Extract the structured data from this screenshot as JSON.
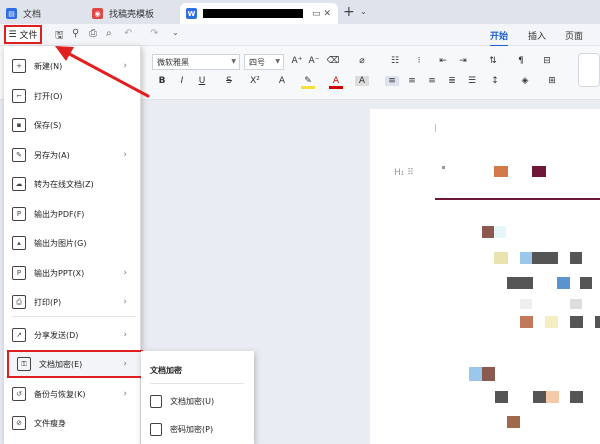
{
  "tabs": [
    {
      "label": "文档",
      "icon": "docs-icon",
      "color": "#2f6ce5"
    },
    {
      "label": "找稿壳模板",
      "icon": "template-icon",
      "color": "#e04848"
    },
    {
      "label": "",
      "icon": "word-doc-icon",
      "color": "#2f6ce5",
      "active": true
    }
  ],
  "menubar": {
    "file_label": "文件",
    "ribbon_tabs": [
      "开始",
      "插入",
      "页面"
    ]
  },
  "ribbon": {
    "font_name": "微软雅黑",
    "font_size": "四号"
  },
  "file_menu": {
    "items": [
      {
        "label": "新建(N)",
        "icon": "new-doc-icon",
        "arrow": true
      },
      {
        "label": "打开(O)",
        "icon": "folder-open-icon",
        "arrow": false
      },
      {
        "label": "保存(S)",
        "icon": "save-icon",
        "arrow": false
      },
      {
        "label": "另存为(A)",
        "icon": "save-as-icon",
        "arrow": true
      },
      {
        "label": "转为在线文档(Z)",
        "icon": "cloud-doc-icon",
        "arrow": false
      },
      {
        "label": "输出为PDF(F)",
        "icon": "pdf-icon",
        "arrow": false
      },
      {
        "label": "输出为图片(G)",
        "icon": "image-icon",
        "arrow": false
      },
      {
        "label": "输出为PPT(X)",
        "icon": "ppt-icon",
        "arrow": true
      },
      {
        "label": "打印(P)",
        "icon": "print-icon",
        "arrow": true
      },
      {
        "label": "分享发送(D)",
        "icon": "share-icon",
        "arrow": true
      },
      {
        "label": "文档加密(E)",
        "icon": "lock-doc-icon",
        "arrow": true
      },
      {
        "label": "备份与恢复(K)",
        "icon": "backup-icon",
        "arrow": true
      },
      {
        "label": "文件瘦身",
        "icon": "slim-icon",
        "arrow": false
      }
    ]
  },
  "submenu": {
    "title": "文档加密",
    "items": [
      {
        "label": "文档加密(U)",
        "icon": "doc-encrypt-icon"
      },
      {
        "label": "密码加密(P)",
        "icon": "password-icon"
      }
    ]
  },
  "accent_color": "#1f5fd1",
  "highlight_color": "#e02020"
}
